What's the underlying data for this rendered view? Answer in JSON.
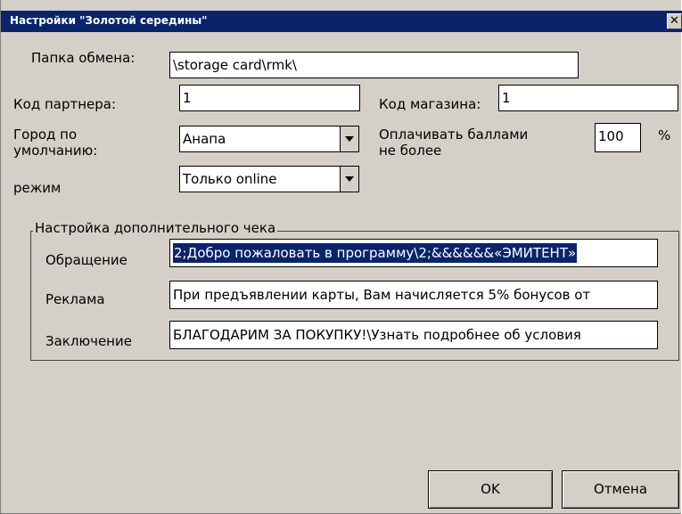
{
  "window": {
    "title": "Настройки \"Золотой середины\"",
    "close_glyph": "✕"
  },
  "fields": {
    "exchange_folder": {
      "label": "Папка обмена:",
      "value": "\\storage card\\rmk\\"
    },
    "partner_code": {
      "label": "Код партнера:",
      "value": "1"
    },
    "store_code": {
      "label": "Код магазина:",
      "value": "1"
    },
    "default_city": {
      "label_line1": "Город по",
      "label_line2": "умолчанию:",
      "value": "Анапа"
    },
    "pay_points": {
      "label_line1": "Оплачивать баллами",
      "label_line2": "не более",
      "value": "100",
      "unit": "%"
    },
    "mode": {
      "label": "режим",
      "value": "Только online"
    }
  },
  "extra_receipt": {
    "group_label": "Настройка дополнительного чека",
    "greeting": {
      "label": "Обращение",
      "value": "2;Добро пожаловать в программу\\2;&&&&&&«ЭМИТЕНТ»"
    },
    "advert": {
      "label": "Реклама",
      "value": "При предъявлении карты, Вам начисляется 5% бонусов от"
    },
    "closing": {
      "label": "Заключение",
      "value": "БЛАГОДАРИМ ЗА ПОКУПКУ!\\Узнать подробнее об условия"
    }
  },
  "buttons": {
    "ok": "OK",
    "cancel": "Отмена"
  }
}
